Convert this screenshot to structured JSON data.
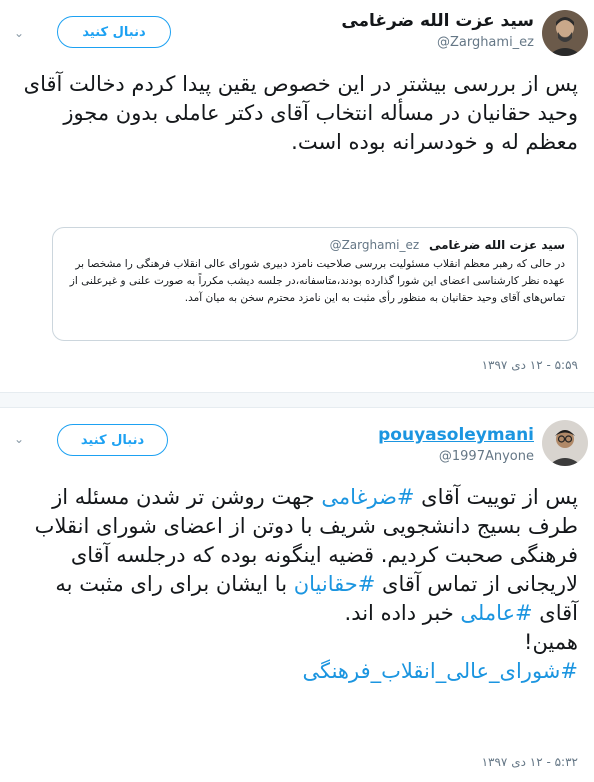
{
  "tweet1": {
    "display_name": "سید عزت الله ضرغامی",
    "username": "@Zarghami_ez",
    "follow_label": "دنبال کنید",
    "text": "پس از بررسی بیشتر در این خصوص یقین پیدا کردم دخالت آقای وحید حقانیان در مسأله انتخاب آقای دکتر عاملی بدون مجوز معظم له و خودسرانه بوده است.",
    "quote": {
      "display_name": "سید عزت الله ضرغامی",
      "username": "@Zarghami_ez",
      "text": "در حالی که رهبر معظم انقلاب مسئولیت بررسی صلاحیت نامزد دبیری شورای عالی انقلاب فرهنگی را مشخصا بر عهده نظر کارشناسی اعضای این شورا گذارده بودند،متاسفانه،در جلسه دیشب مکرراً به صورت علنی و غیرعلنی از تماس‌های آقای وحید حقانیان به منظور رأی مثبت به این نامزد محترم سخن به میان آمد."
    },
    "timestamp": "۵:۵۹ - ۱۲ دی ۱۳۹۷"
  },
  "tweet2": {
    "display_name": "pouyasoleymani",
    "username": "@1997Anyone",
    "follow_label": "دنبال کنید",
    "text_parts": {
      "p1": "پس از توییت آقای ",
      "h1": "#ضرغامی",
      "p2": " جهت روشن تر شدن مسئله از طرف بسیج دانشجویی شریف با دوتن از اعضای شورای انقلاب فرهنگی صحبت کردیم. قضیه اینگونه بوده که درجلسه آقای لاریجانی از تماس آقای ",
      "h2": "#حقانیان",
      "p3": " با ایشان برای رای مثبت به آقای ",
      "h3": "#عاملی",
      "p4": " خبر داده اند.",
      "p5": "همین!",
      "h4": "#شورای_عالی_انقلاب_فرهنگی"
    },
    "timestamp": "۵:۳۲ - ۱۲ دی ۱۳۹۷"
  },
  "icons": {
    "chevron": "chevron-down-icon",
    "avatar1": "avatar",
    "avatar2": "avatar"
  },
  "colors": {
    "accent": "#1da1f2",
    "hashtag": "#1b95e0",
    "muted": "#657786"
  }
}
